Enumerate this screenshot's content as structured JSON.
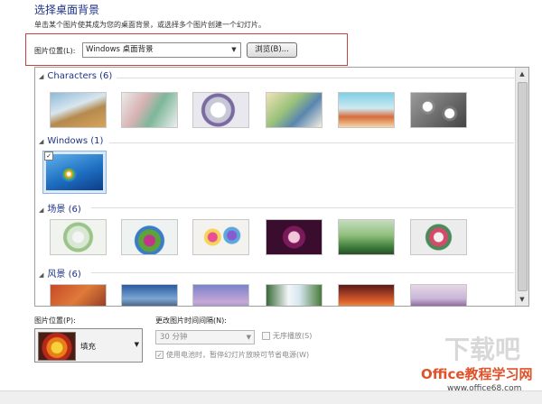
{
  "header": {
    "title": "选择桌面背景",
    "description": "单击某个图片使其成为您的桌面背景，或选择多个图片创建一个幻灯片。"
  },
  "picture_location": {
    "label": "图片位置(L):",
    "value": "Windows 桌面背景",
    "browse_label": "浏览(B)..."
  },
  "gallery": {
    "groups": [
      {
        "name": "Characters (6)",
        "count": 6
      },
      {
        "name": "Windows (1)",
        "count": 1
      },
      {
        "name": "场景 (6)",
        "count": 6
      },
      {
        "name": "风景 (6)",
        "count": 6
      }
    ]
  },
  "position": {
    "label": "图片位置(P):",
    "value": "填充"
  },
  "interval": {
    "label": "更改图片时间间隔(N):",
    "value": "30 分钟",
    "shuffle_label": "无序播放(S)",
    "battery_label": "使用电池时，暂停幻灯片放映可节省电源(W)",
    "battery_checked": true,
    "shuffle_checked": false
  },
  "watermark": {
    "line1": "Office教程学习网",
    "line2": "www.office68.com",
    "logo": "下载吧"
  },
  "colors": {
    "accent": "#1e3287",
    "highlight_border": "#c8433d"
  }
}
